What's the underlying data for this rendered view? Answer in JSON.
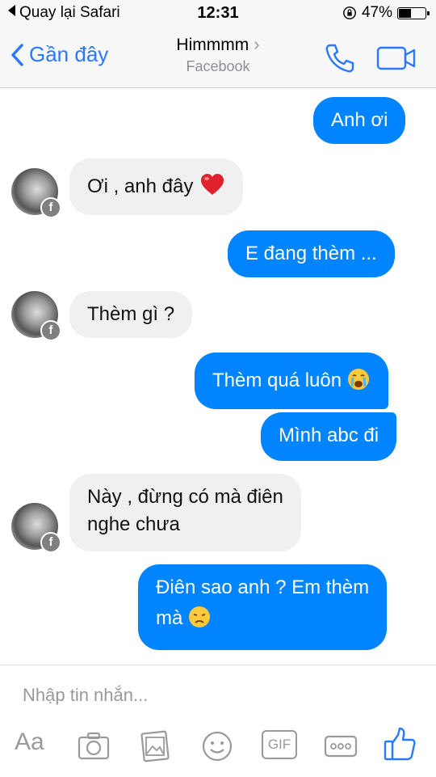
{
  "status_bar": {
    "back_label": "Quay lại Safari",
    "time": "12:31",
    "battery_percent": "47%",
    "battery_level": 0.47
  },
  "nav": {
    "back_label": "Gần đây",
    "title": "Himmmm",
    "subtitle": "Facebook",
    "icons": [
      "chevron-left-icon",
      "phone-icon",
      "video-camera-icon"
    ]
  },
  "messages": [
    {
      "side": "out",
      "text": "Anh ơi"
    },
    {
      "side": "in",
      "text": "Ơi , anh đây",
      "emoji": "heart"
    },
    {
      "side": "out",
      "text": "E đang thèm ..."
    },
    {
      "side": "in",
      "text": "Thèm gì ?"
    },
    {
      "side": "out",
      "text": "Thèm quá luôn",
      "emoji": "crying-face"
    },
    {
      "side": "out",
      "text": "Mình abc đi"
    },
    {
      "side": "in",
      "text_line1": "Này , đừng có mà điên",
      "text_line2": "nghe chưa"
    },
    {
      "side": "out",
      "text_line1": "Điên sao anh ? Em thèm",
      "text_line2": "mà",
      "emoji": "disappointed-face"
    }
  ],
  "avatar_badge": "f",
  "composer": {
    "placeholder": "Nhập tin nhắn...",
    "tools": {
      "text_label": "Aa",
      "gif_label": "GIF"
    }
  },
  "colors": {
    "accent": "#2979ff",
    "outgoing_bubble": "#0084ff",
    "incoming_bubble": "#f0f0f0"
  }
}
